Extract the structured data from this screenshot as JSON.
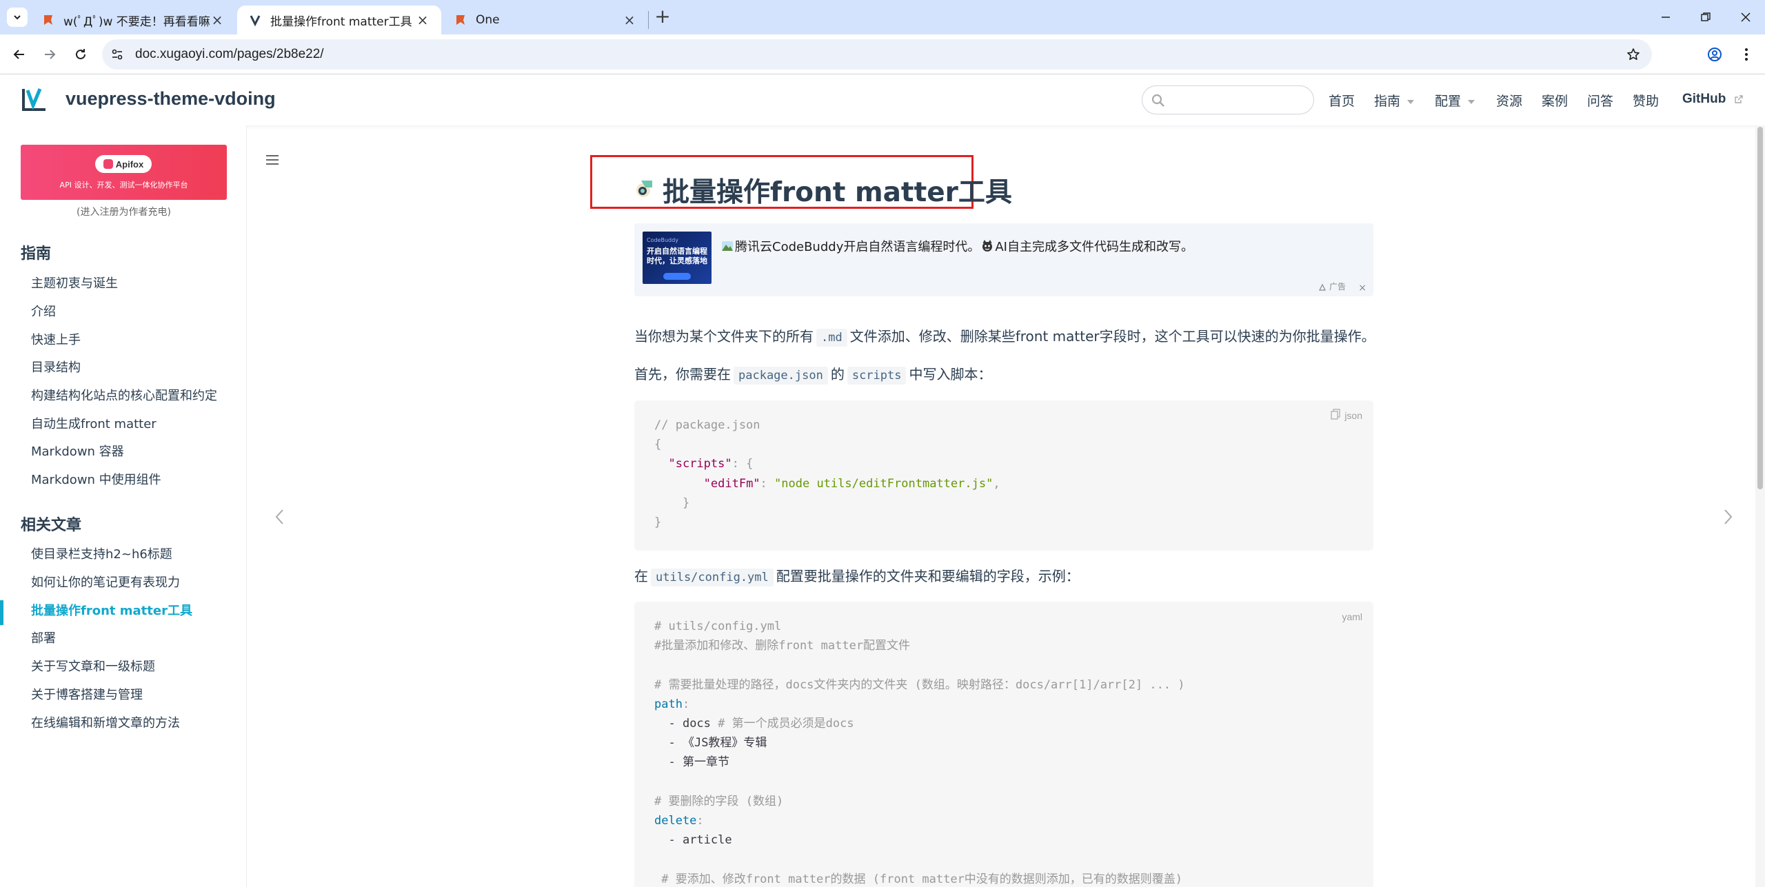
{
  "browser": {
    "tabs": [
      {
        "title": "w(ﾟДﾟ)w 不要走！再看看嘛！",
        "active": false
      },
      {
        "title": "批量操作front matter工具 | vu",
        "active": true
      },
      {
        "title": "One",
        "active": false
      }
    ],
    "url": "doc.xugaoyi.com/pages/2b8e22/"
  },
  "navbar": {
    "site_name": "vuepress-theme-vdoing",
    "search_placeholder": "",
    "items": [
      {
        "label": "首页",
        "dropdown": false
      },
      {
        "label": "指南",
        "dropdown": true
      },
      {
        "label": "配置",
        "dropdown": true
      },
      {
        "label": "资源",
        "dropdown": false
      },
      {
        "label": "案例",
        "dropdown": false
      },
      {
        "label": "问答",
        "dropdown": false
      },
      {
        "label": "赞助",
        "dropdown": false
      },
      {
        "label": "GitHub",
        "dropdown": false
      }
    ]
  },
  "sidebar": {
    "ad": {
      "brand": "Apifox",
      "tagline": "API 设计、开发、测试一体化协作平台",
      "note": "(进入注册为作者充电)"
    },
    "groups": [
      {
        "title": "指南",
        "items": [
          "主题初衷与诞生",
          "介绍",
          "快速上手",
          "目录结构",
          "构建结构化站点的核心配置和约定",
          "自动生成front matter",
          "Markdown 容器",
          "Markdown 中使用组件"
        ]
      },
      {
        "title": "相关文章",
        "items": [
          "使目录栏支持h2~h6标题",
          "如何让你的笔记更有表现力",
          "批量操作front matter工具",
          "部署",
          "关于写文章和一级标题",
          "关于博客搭建与管理",
          "在线编辑和新增文章的方法"
        ]
      }
    ],
    "active_item": "批量操作front matter工具"
  },
  "main": {
    "title": "批量操作front matter工具",
    "ad": {
      "thumb_small": "CodeBuddy",
      "thumb_text": "开启自然语言编程时代，让灵感落地",
      "text_a": "腾讯云CodeBuddy开启自然语言编程时代。",
      "text_b": "AI自主完成多文件代码生成和改写。",
      "tag": "广告",
      "close": "×"
    },
    "p1": {
      "a": "当你想为某个文件夹下的所有",
      "code": ".md",
      "b": "文件添加、修改、删除某些front matter字段时，这个工具可以快速的为你批量操作。"
    },
    "p2": {
      "a": "首先，你需要在",
      "code1": "package.json",
      "b": "的",
      "code2": "scripts",
      "c": "中写入脚本："
    },
    "code1": {
      "lang": "json",
      "lines": {
        "l1": "// package.json",
        "l2": "{",
        "l3_key": "\"scripts\"",
        "l3_rest": ": {",
        "l4_key": "\"editFm\"",
        "l4_colon": ": ",
        "l4_val": "\"node utils/editFrontmatter.js\"",
        "l4_end": ",",
        "l5": "}",
        "l6": "}"
      }
    },
    "p3": {
      "a": "在",
      "code": "utils/config.yml",
      "b": "配置要批量操作的文件夹和要编辑的字段，示例："
    },
    "code2": {
      "lang": "yaml",
      "lines": {
        "l1": "# utils/config.yml",
        "l2": "#批量添加和修改、删除front matter配置文件",
        "l4": "# 需要批量处理的路径，docs文件夹内的文件夹 (数组。映射路径：docs/arr[1]/arr[2] ... )",
        "l5_key": "path",
        "l6_a": "- docs ",
        "l6_c": "# 第一个成员必须是docs",
        "l7": "- 《JS教程》专辑",
        "l8": "- 第一章节",
        "l10": "# 要删除的字段 (数组)",
        "l11_key": "delete",
        "l12": "- article",
        "l14": " # 要添加、修改front matter的数据 (front matter中没有的数据则添加，已有的数据则覆盖)"
      }
    }
  }
}
